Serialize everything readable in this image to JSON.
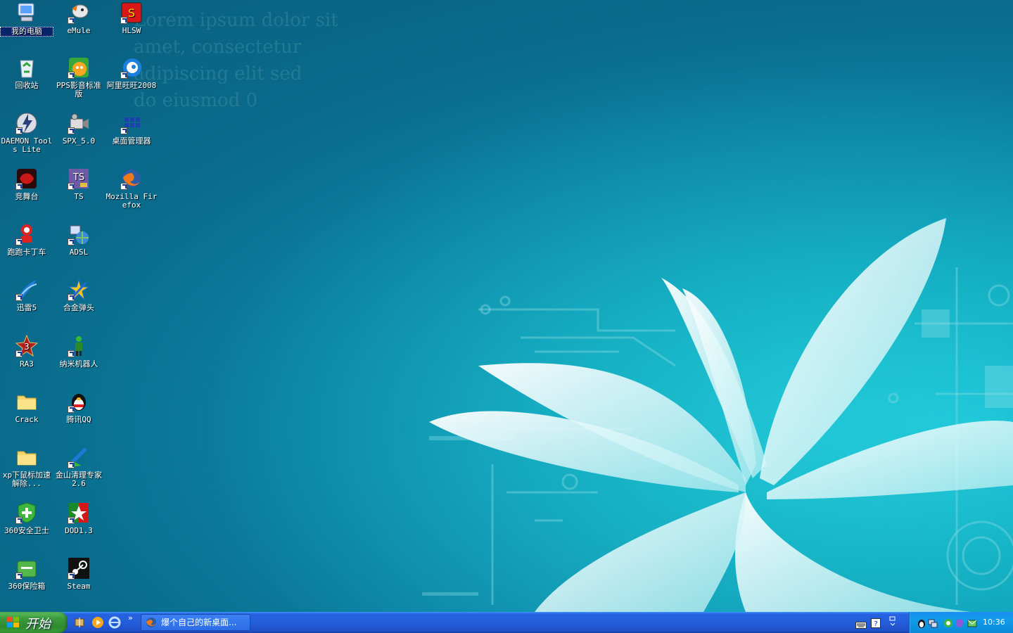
{
  "desktop": {
    "icons": [
      {
        "label": "我的电脑",
        "icon": "my-computer-icon"
      },
      {
        "label": "eMule",
        "icon": "emule-icon"
      },
      {
        "label": "HLSW",
        "icon": "hlsw-icon"
      },
      {
        "label": "回收站",
        "icon": "recycle-bin-icon"
      },
      {
        "label": "PPS影音标准版",
        "icon": "pps-icon"
      },
      {
        "label": "阿里旺旺2008",
        "icon": "aliwangwang-icon"
      },
      {
        "label": "DAEMON Tools Lite",
        "icon": "daemon-tools-icon"
      },
      {
        "label": "SPX_5.0",
        "icon": "spx-camera-icon"
      },
      {
        "label": "桌面管理器",
        "icon": "desktop-manager-icon"
      },
      {
        "label": "竞舞台",
        "icon": "jingwutai-icon"
      },
      {
        "label": "TS",
        "icon": "teamspeak-icon"
      },
      {
        "label": "Mozilla Firefox",
        "icon": "firefox-icon"
      },
      {
        "label": "跑跑卡丁车",
        "icon": "kartrider-icon"
      },
      {
        "label": "ADSL",
        "icon": "adsl-network-icon"
      },
      {
        "label": "迅雷5",
        "icon": "thunder-icon"
      },
      {
        "label": "合金弹头",
        "icon": "metal-slug-icon"
      },
      {
        "label": "RA3",
        "icon": "ra3-icon"
      },
      {
        "label": "纳米机器人",
        "icon": "nanobot-icon"
      },
      {
        "label": "Crack",
        "icon": "folder-icon"
      },
      {
        "label": "腾讯QQ",
        "icon": "qq-penguin-icon"
      },
      {
        "label": "xp下鼠标加速解除...",
        "icon": "folder-icon"
      },
      {
        "label": "金山清理专家 2.6",
        "icon": "kingsoft-cleaner-icon"
      },
      {
        "label": "360安全卫士",
        "icon": "360-safe-icon"
      },
      {
        "label": "DOD1.3",
        "icon": "dod-icon"
      },
      {
        "label": "360保险箱",
        "icon": "360-safebox-icon"
      },
      {
        "label": "Steam",
        "icon": "steam-icon"
      }
    ],
    "wallpaper_text": "Lorem ipsum dolor sit\namet, consectetur\nadipiscing elit sed\ndo eiusmod 0"
  },
  "taskbar": {
    "start_label": "开始",
    "quick_launch": [
      "show-desktop-icon",
      "media-player-icon",
      "internet-explorer-icon"
    ],
    "more": "»",
    "task": {
      "label": "爆个自己的新桌面..."
    },
    "tray_clock": "10:36"
  },
  "colors": {
    "taskbar": "#245edb",
    "start": "#3c9c3c",
    "tray": "#109ce8",
    "desktop": "#0a6f8f"
  }
}
